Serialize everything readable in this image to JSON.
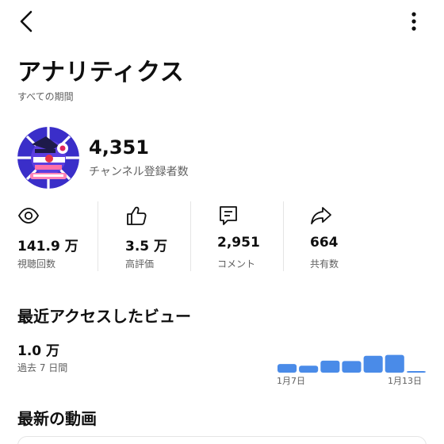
{
  "header": {
    "back_icon": "chevron-left-icon",
    "more_icon": "more-vertical-icon",
    "title": "アナリティクス",
    "period": "すべての期間"
  },
  "channel": {
    "subscriber_count": "4,351",
    "subscriber_label": "チャンネル登録者数"
  },
  "stats": [
    {
      "icon": "eye-icon",
      "value": "141.9 万",
      "label": "視聴回数"
    },
    {
      "icon": "thumbs-up-icon",
      "value": "3.5 万",
      "label": "高評価"
    },
    {
      "icon": "comment-icon",
      "value": "2,951",
      "label": "コメント"
    },
    {
      "icon": "share-icon",
      "value": "664",
      "label": "共有数"
    }
  ],
  "recent": {
    "title": "最近アクセスしたビュー",
    "value": "1.0 万",
    "period": "過去 7 日間"
  },
  "chart_data": {
    "type": "bar",
    "categories": [
      "1月7日",
      "",
      "",
      "",
      "",
      "1月13日",
      ""
    ],
    "values": [
      0.21,
      0.17,
      0.29,
      0.28,
      0.41,
      0.43,
      0.02
    ],
    "tick_labels": [
      "1月7日",
      "1月13日"
    ],
    "bar_color": "#4a8be8",
    "grid": false
  },
  "latest": {
    "title": "最新の動画"
  },
  "colors": {
    "text": "#0f0f0f",
    "secondary_text": "#606060",
    "accent": "#4a8be8",
    "divider": "#e5e5e5"
  }
}
